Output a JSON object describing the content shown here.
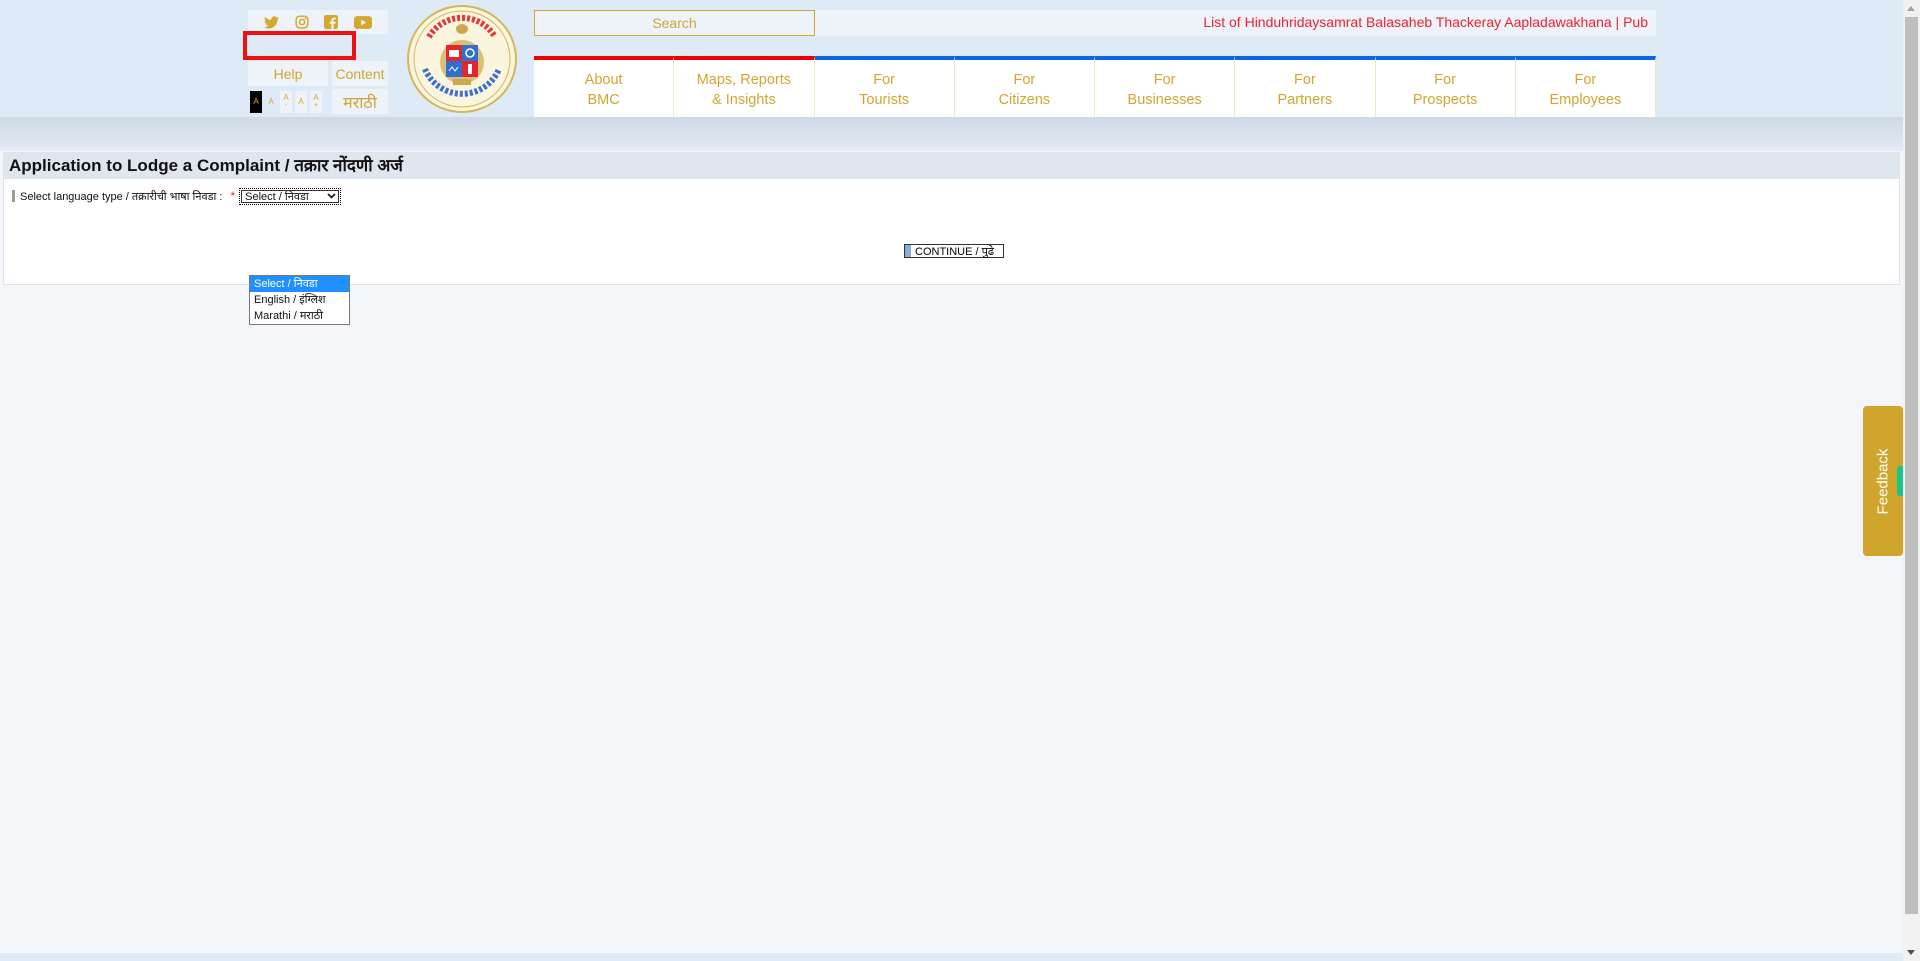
{
  "header": {
    "social": [
      {
        "name": "twitter-icon"
      },
      {
        "name": "instagram-icon"
      },
      {
        "name": "facebook-icon"
      },
      {
        "name": "youtube-icon"
      }
    ],
    "help_label": "Help",
    "content_label": "Content",
    "font_sizes": [
      {
        "label": "A",
        "sub": ""
      },
      {
        "label": "A",
        "sub": ""
      },
      {
        "label": "A",
        "sub": "-"
      },
      {
        "label": "A",
        "sub": ""
      },
      {
        "label": "A",
        "sub": "+"
      }
    ],
    "language_toggle": "मराठी",
    "logo_alt": "Brihanmumbai Municipal Corporation",
    "search_placeholder": "Search",
    "ticker": "List of Hinduhridaysamrat Balasaheb Thackeray Aapladawakhana | Pub",
    "nav": [
      {
        "line1": "About",
        "line2": "BMC"
      },
      {
        "line1": "Maps, Reports",
        "line2": "& Insights"
      },
      {
        "line1": "For",
        "line2": "Tourists"
      },
      {
        "line1": "For",
        "line2": "Citizens"
      },
      {
        "line1": "For",
        "line2": "Businesses"
      },
      {
        "line1": "For",
        "line2": "Partners"
      },
      {
        "line1": "For",
        "line2": "Prospects"
      },
      {
        "line1": "For",
        "line2": "Employees"
      }
    ]
  },
  "form": {
    "title": "Application to Lodge a Complaint / तक्रार नोंदणी अर्ज",
    "language_label": "Select language type / तक्रारीची भाषा निवडा :",
    "required_mark": "*",
    "language_selected": "Select / निवडा",
    "language_options": [
      "Select / निवडा",
      "English / इंग्लिश",
      "Marathi / मराठी"
    ],
    "continue_label": "CONTINUE / पुढे"
  },
  "feedback_label": "Feedback",
  "colors": {
    "brand_gold": "#d1a630",
    "nav_red": "#ee0000",
    "nav_blue": "#0a66e8",
    "ticker_red": "#ee2233",
    "dropdown_highlight": "#1e90ff"
  }
}
